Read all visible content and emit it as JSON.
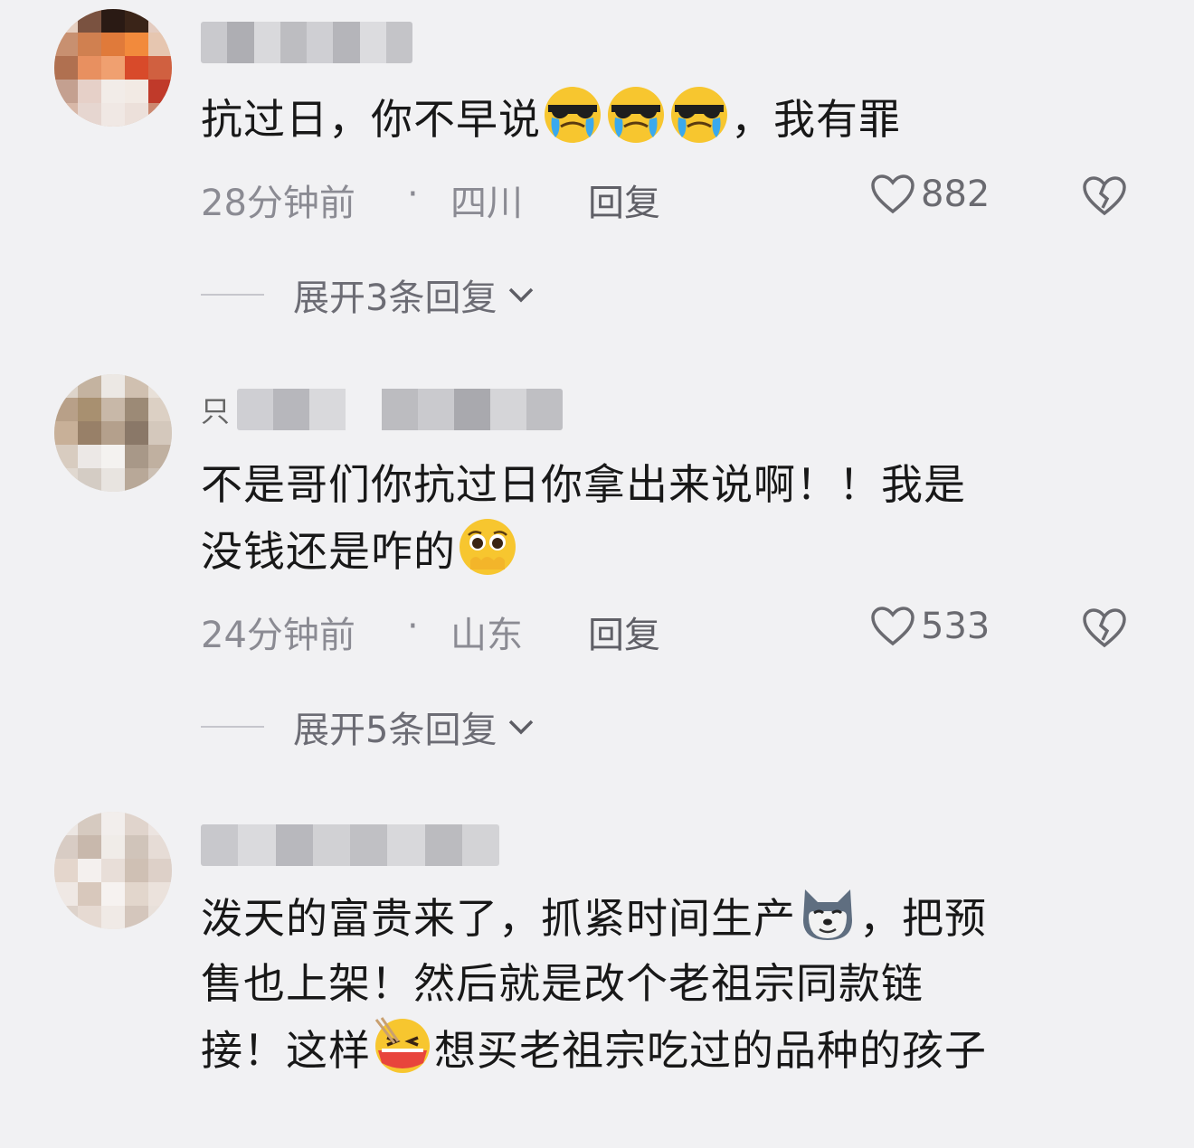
{
  "comments": [
    {
      "name_visible": "",
      "text_parts": [
        "抗过日，你不早说",
        "，我有罪"
      ],
      "emoji": [
        "cool-crying-emoji",
        "cool-crying-emoji",
        "cool-crying-emoji"
      ],
      "time": "28分钟前",
      "separator": "·",
      "location": "四川",
      "reply_label": "回复",
      "likes": "882",
      "expand_label": "展开3条回复"
    },
    {
      "name_visible": "只",
      "text_line1": "不是哥们你抗过日你拿出来说啊！！我是",
      "text_line2": "没钱还是咋的",
      "emoji": [
        "pleading-emoji"
      ],
      "time": "24分钟前",
      "separator": "·",
      "location": "山东",
      "reply_label": "回复",
      "likes": "533",
      "expand_label": "展开5条回复"
    },
    {
      "name_visible": "",
      "text_line1a": "泼天的富贵来了，抓紧时间生产",
      "text_line1b": "，把预",
      "text_line2": "售也上架！然后就是改个老祖宗同款链",
      "text_line3a": "接！这样",
      "text_line3b": "想买老祖宗吃过的品种的孩子",
      "emoji": [
        "doge-emoji",
        "eating-emoji"
      ]
    }
  ],
  "colors": {
    "background": "#f1f1f3",
    "text": "#181818",
    "meta": "#8b8b93"
  }
}
